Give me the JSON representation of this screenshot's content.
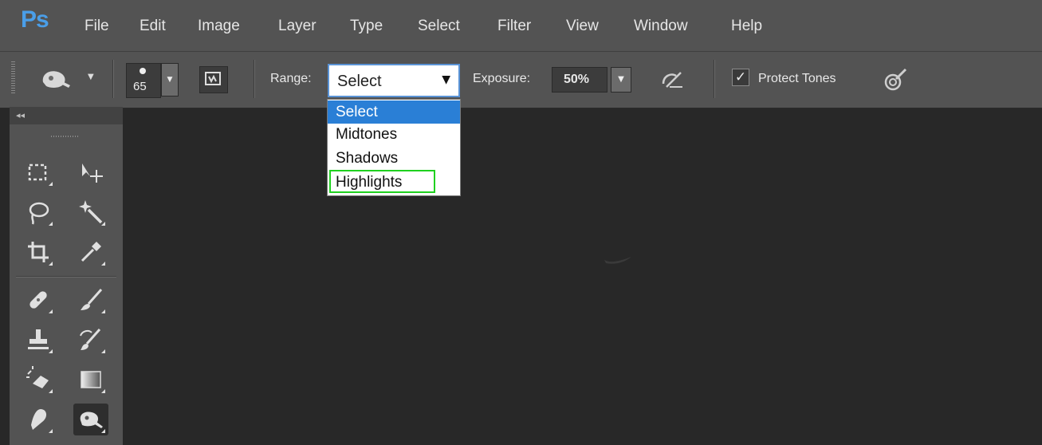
{
  "app": {
    "logo": "Ps"
  },
  "menu": [
    "File",
    "Edit",
    "Image",
    "Layer",
    "Type",
    "Select",
    "Filter",
    "View",
    "Window",
    "Help"
  ],
  "options": {
    "brush_size": "65",
    "range_label": "Range:",
    "range_selected": "Select",
    "range_options": [
      "Select",
      "Midtones",
      "Shadows",
      "Highlights"
    ],
    "exposure_label": "Exposure:",
    "exposure_value": "50%",
    "protect_tones_label": "Protect Tones",
    "protect_tones_checked": true
  },
  "toolbar": {
    "collapse_glyph": "◂◂",
    "tools": [
      "rectangular-marquee",
      "move",
      "lasso",
      "magic-wand",
      "crop",
      "eyedropper",
      "spot-healing-brush",
      "brush",
      "clone-stamp",
      "history-brush",
      "eraser",
      "gradient",
      "blur",
      "dodge"
    ],
    "active_tool": "dodge"
  },
  "colors": {
    "accent": "#2a7fd6",
    "highlight_outline": "#1fd11f",
    "chrome": "#535353",
    "canvas": "#282828"
  }
}
